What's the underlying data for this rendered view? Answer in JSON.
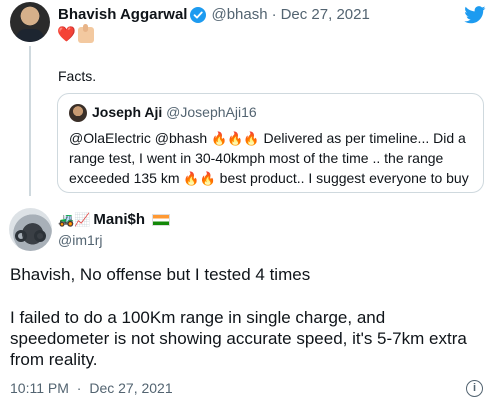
{
  "main_tweet": {
    "author_name": "Bhavish Aggarwal",
    "author_handle": "@bhash",
    "separator": "·",
    "date": "Dec 27, 2021",
    "emojis": {
      "heart": "❤️",
      "thumb": "👍"
    },
    "text": "Facts."
  },
  "quoted_tweet": {
    "author_name": "Joseph Aji",
    "author_handle": "@JosephAji16",
    "text_part1": "@OlaElectric @bhash ",
    "fire": "🔥🔥🔥",
    "text_part2": " Delivered as per timeline... Did a range test, I went in 30-40kmph most of the time .. the range exceeded 135 km ",
    "fire2": "🔥🔥",
    "text_part3": " best product.. I suggest everyone to buy"
  },
  "reply_tweet": {
    "author_name_prefix": "🚜📈",
    "author_name": "Mani$h",
    "author_handle": "@im1rj",
    "paragraph1": "Bhavish, No offense but I tested 4 times",
    "paragraph2": "I failed to do a 100Km range in single charge, and speedometer is not showing accurate speed, it's 5-7km extra from reality.",
    "time": "10:11 PM",
    "separator": "·",
    "date": "Dec 27, 2021"
  },
  "colors": {
    "verified": "#1d9bf0",
    "twitter_blue": "#1d9bf0",
    "muted_text": "#536471",
    "heart": "#e0245e"
  }
}
